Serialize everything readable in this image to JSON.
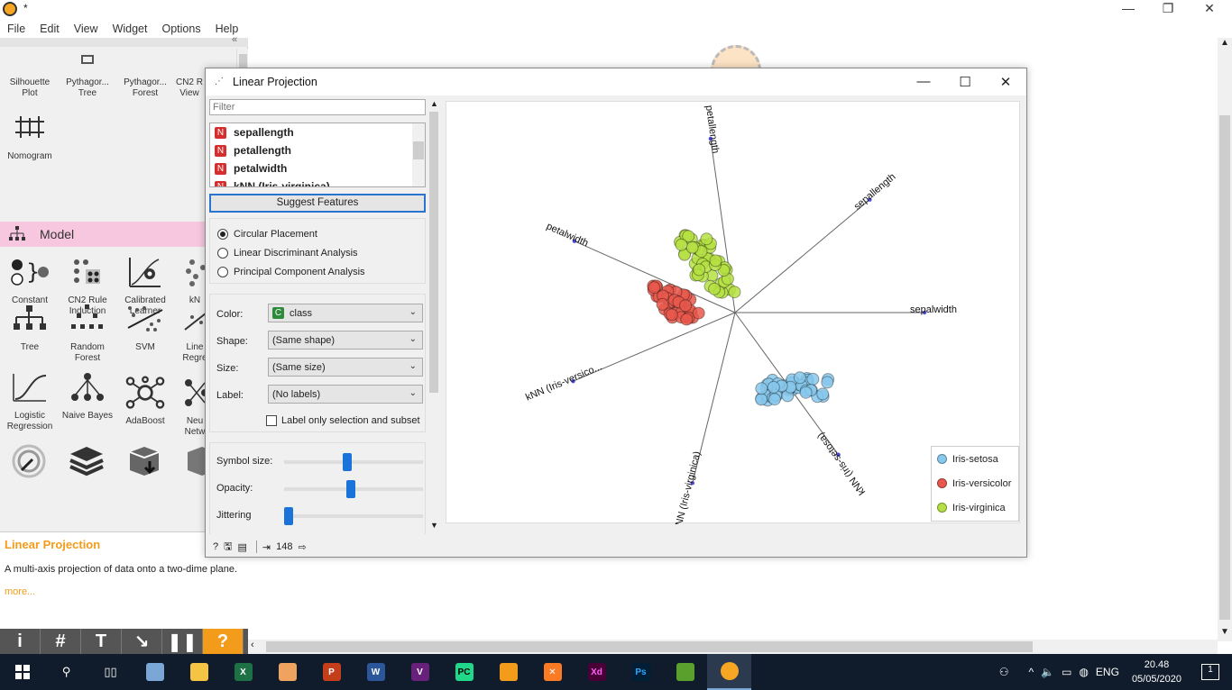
{
  "app": {
    "title": "*"
  },
  "menu": [
    "File",
    "Edit",
    "View",
    "Widget",
    "Options",
    "Help"
  ],
  "widgets_top": [
    {
      "label": "Silhouette Plot",
      "icon": "silhouette-icon"
    },
    {
      "label": "Pythagor... Tree",
      "icon": "pythagorean-tree-icon"
    },
    {
      "label": "Pythagor... Forest",
      "icon": "pythagorean-forest-icon"
    },
    {
      "label": "CN2 R View",
      "icon": "cn2-viewer-icon"
    }
  ],
  "nomogram": {
    "label": "Nomogram"
  },
  "model_section": {
    "title": "Model"
  },
  "model_widgets": [
    {
      "label": "Constant",
      "icon": "constant-icon"
    },
    {
      "label": "CN2 Rule Induction",
      "icon": "cn2-rule-icon"
    },
    {
      "label": "Calibrated Learner",
      "icon": "calibrated-learner-icon"
    },
    {
      "label": "kN",
      "icon": "knn-icon"
    },
    {
      "label": "Tree",
      "icon": "tree-icon"
    },
    {
      "label": "Random Forest",
      "icon": "random-forest-icon"
    },
    {
      "label": "SVM",
      "icon": "svm-icon"
    },
    {
      "label": "Line Regre",
      "icon": "linear-regression-icon"
    },
    {
      "label": "Logistic Regression",
      "icon": "logistic-regression-icon"
    },
    {
      "label": "Naive Bayes",
      "icon": "naive-bayes-icon"
    },
    {
      "label": "AdaBoost",
      "icon": "adaboost-icon"
    },
    {
      "label": "Neu Netw",
      "icon": "neural-network-icon"
    }
  ],
  "description": {
    "title": "Linear Projection",
    "text": "A multi-axis projection of data onto a two-dime plane.",
    "more": "more..."
  },
  "dialog": {
    "title": "Linear Projection",
    "filter_placeholder": "Filter",
    "features": [
      "sepallength",
      "petallength",
      "petalwidth",
      "kNN (Iris-virginica)"
    ],
    "suggest_button": "Suggest Features",
    "placements": [
      "Circular Placement",
      "Linear Discriminant Analysis",
      "Principal Component Analysis"
    ],
    "selected_placement": 0,
    "color_label": "Color:",
    "color_value": "class",
    "color_badge": "C",
    "shape_label": "Shape:",
    "shape_value": "(Same shape)",
    "size_label": "Size:",
    "size_value": "(Same size)",
    "label_label": "Label:",
    "label_value": "(No labels)",
    "label_only_selection": "Label only selection and subset",
    "symbol_size_label": "Symbol size:",
    "symbol_size": 0.45,
    "opacity_label": "Opacity:",
    "opacity": 0.48,
    "jittering_label": "Jittering",
    "jittering": 0.0,
    "status_count": "148"
  },
  "projection": {
    "axes": [
      {
        "name": "petallength",
        "angle": 98
      },
      {
        "name": "sepallength",
        "angle": 40
      },
      {
        "name": "petalwidth",
        "angle": 156
      },
      {
        "name": "sepalwidth",
        "angle": 0
      },
      {
        "name": "kNN (Iris-versico...",
        "angle": 203
      },
      {
        "name": "kNN (Iris-virginica)",
        "angle": 256
      },
      {
        "name": "kNN (Iris-setosa)",
        "angle": 306
      }
    ],
    "legend": [
      {
        "name": "Iris-setosa",
        "color": "#87c8ec"
      },
      {
        "name": "Iris-versicolor",
        "color": "#e8584c"
      },
      {
        "name": "Iris-virginica",
        "color": "#b5e043"
      }
    ]
  },
  "taskbar": {
    "lang": "ENG",
    "time": "20.48",
    "date": "05/05/2020",
    "notif": "1"
  }
}
